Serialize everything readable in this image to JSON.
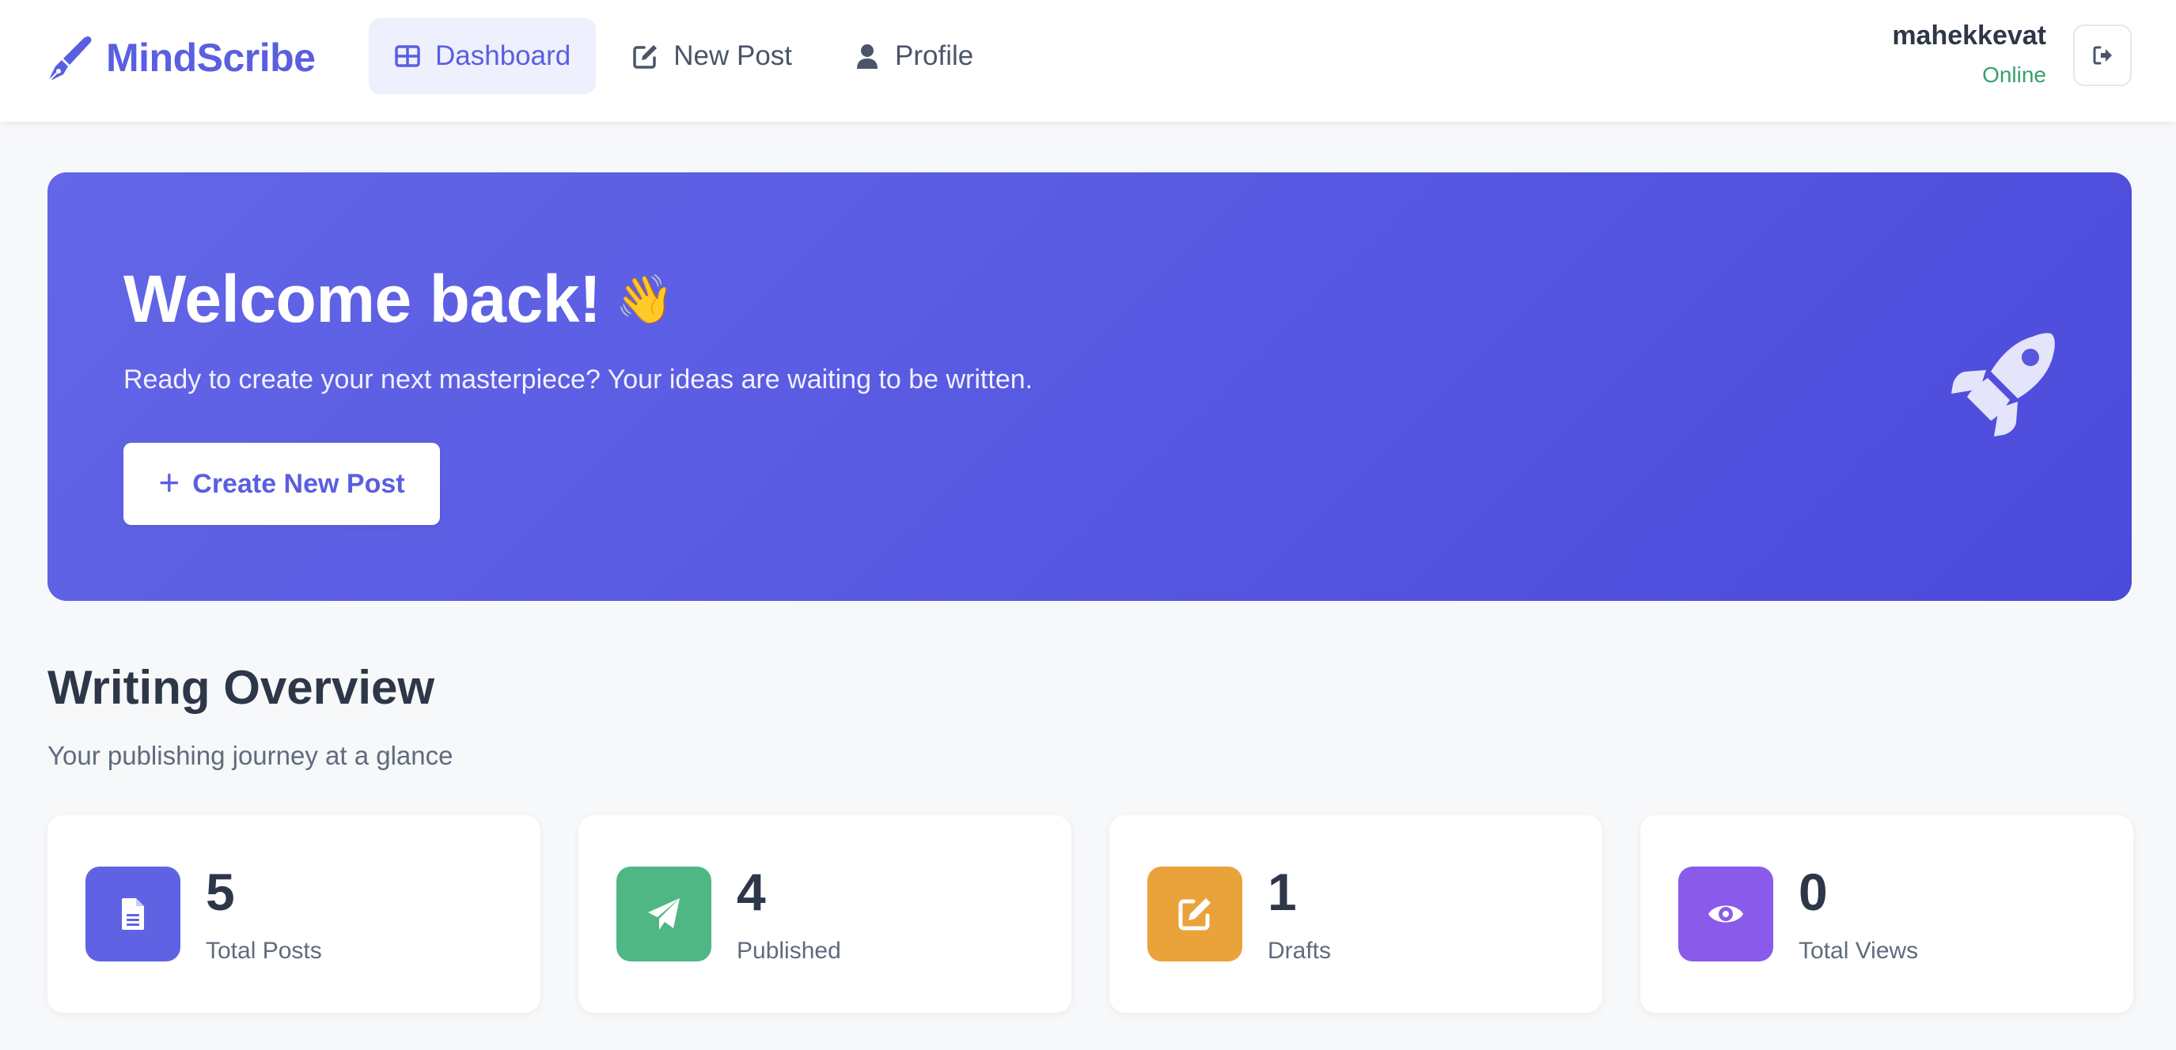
{
  "brand": {
    "name": "MindScribe",
    "icon": "pen-nib-icon",
    "color": "#5a5fe0"
  },
  "nav": {
    "items": [
      {
        "label": "Dashboard",
        "icon": "dashboard-grid-icon",
        "active": true
      },
      {
        "label": "New Post",
        "icon": "edit-icon",
        "active": false
      },
      {
        "label": "Profile",
        "icon": "user-icon",
        "active": false
      }
    ]
  },
  "user": {
    "name": "mahekkevat",
    "status": "Online",
    "status_color": "#38a169",
    "logout_icon": "logout-icon"
  },
  "hero": {
    "title": "Welcome back!",
    "emoji": "👋",
    "subtitle": "Ready to create your next masterpiece? Your ideas are waiting to be written.",
    "button_label": "Create New Post",
    "button_icon": "plus-icon",
    "illustration": "rocket-icon",
    "gradient": [
      "#6366e6",
      "#4c4adb"
    ]
  },
  "overview": {
    "title": "Writing Overview",
    "subtitle": "Your publishing journey at a glance",
    "stats": [
      {
        "value": "5",
        "label": "Total Posts",
        "icon": "document-icon",
        "color": "#5f63e3"
      },
      {
        "value": "4",
        "label": "Published",
        "icon": "paper-plane-icon",
        "color": "#4fb783"
      },
      {
        "value": "1",
        "label": "Drafts",
        "icon": "edit-icon",
        "color": "#eaa23a"
      },
      {
        "value": "0",
        "label": "Total Views",
        "icon": "eye-icon",
        "color": "#8a5bea"
      }
    ]
  }
}
